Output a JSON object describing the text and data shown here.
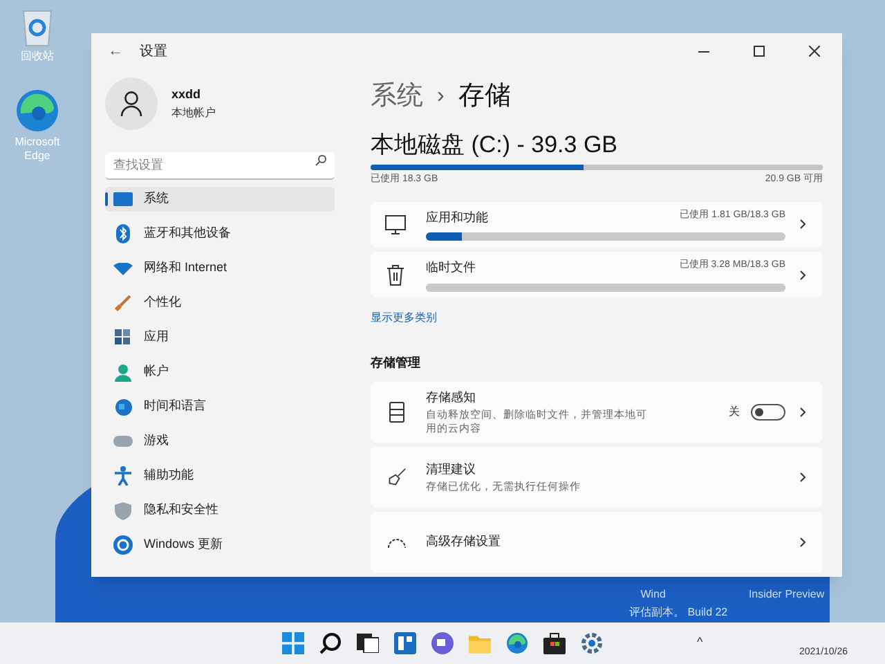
{
  "desktop": {
    "icons": [
      {
        "kind": "recycle",
        "label": "回收站"
      },
      {
        "kind": "edge",
        "label": "Microsoft Edge"
      }
    ],
    "watermark_lines": [
      "Wind",
      "Insider Preview",
      "评估副本。 Build 22"
    ]
  },
  "window": {
    "title": "设置",
    "back": "←"
  },
  "account": {
    "name": "xxdd",
    "type": "本地帐户"
  },
  "search": {
    "placeholder": "查找设置"
  },
  "sidebar": {
    "items": [
      {
        "label": "系统",
        "selected": true
      },
      {
        "label": "蓝牙和其他设备",
        "selected": false
      },
      {
        "label": "网络和 Internet",
        "selected": false
      },
      {
        "label": "个性化",
        "selected": false
      },
      {
        "label": "应用",
        "selected": false
      },
      {
        "label": "帐户",
        "selected": false
      },
      {
        "label": "时间和语言",
        "selected": false
      },
      {
        "label": "游戏",
        "selected": false
      },
      {
        "label": "辅助功能",
        "selected": false
      },
      {
        "label": "隐私和安全性",
        "selected": false
      },
      {
        "label": "Windows 更新",
        "selected": false
      }
    ]
  },
  "breadcrumb": {
    "parent": "系统",
    "separator": "›",
    "current": "存储"
  },
  "disk": {
    "title": "本地磁盘 (C:) - 39.3 GB",
    "level": 0.47,
    "used": "已使用 18.3 GB",
    "free": "20.9 GB 可用"
  },
  "categories": [
    {
      "label": "应用和功能",
      "usage": "已使用 1.81 GB/18.3 GB",
      "level": 0.1
    },
    {
      "label": "临时文件",
      "usage": "已使用 3.28 MB/18.3 GB",
      "level": 0.0
    }
  ],
  "show_more": "显示更多类别",
  "management": {
    "heading": "存储管理",
    "rows": [
      {
        "kind": "toggle",
        "title": "存储感知",
        "description": "自动释放空间、删除临时文件，并管理本地可用的云内容",
        "state_label": "关",
        "on": false
      },
      {
        "kind": "link",
        "title": "清理建议",
        "description": "存储已优化，无需执行任何操作"
      },
      {
        "kind": "link",
        "title": "高级存储设置"
      }
    ]
  },
  "taskbar": {
    "tray_arrow": "^",
    "date": "2021/10/26"
  }
}
